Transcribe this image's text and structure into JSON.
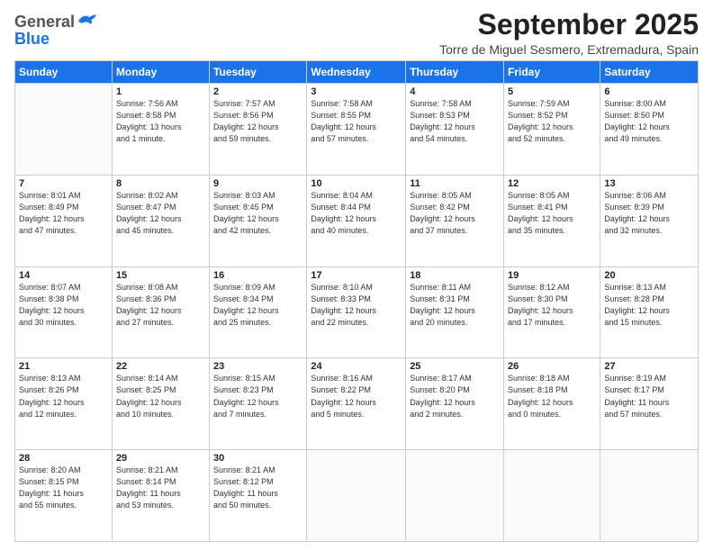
{
  "header": {
    "logo_line1": "General",
    "logo_line2": "Blue",
    "month_title": "September 2025",
    "location": "Torre de Miguel Sesmero, Extremadura, Spain"
  },
  "weekdays": [
    "Sunday",
    "Monday",
    "Tuesday",
    "Wednesday",
    "Thursday",
    "Friday",
    "Saturday"
  ],
  "weeks": [
    [
      {
        "day": "",
        "info": ""
      },
      {
        "day": "1",
        "info": "Sunrise: 7:56 AM\nSunset: 8:58 PM\nDaylight: 13 hours\nand 1 minute."
      },
      {
        "day": "2",
        "info": "Sunrise: 7:57 AM\nSunset: 8:56 PM\nDaylight: 12 hours\nand 59 minutes."
      },
      {
        "day": "3",
        "info": "Sunrise: 7:58 AM\nSunset: 8:55 PM\nDaylight: 12 hours\nand 57 minutes."
      },
      {
        "day": "4",
        "info": "Sunrise: 7:58 AM\nSunset: 8:53 PM\nDaylight: 12 hours\nand 54 minutes."
      },
      {
        "day": "5",
        "info": "Sunrise: 7:59 AM\nSunset: 8:52 PM\nDaylight: 12 hours\nand 52 minutes."
      },
      {
        "day": "6",
        "info": "Sunrise: 8:00 AM\nSunset: 8:50 PM\nDaylight: 12 hours\nand 49 minutes."
      }
    ],
    [
      {
        "day": "7",
        "info": "Sunrise: 8:01 AM\nSunset: 8:49 PM\nDaylight: 12 hours\nand 47 minutes."
      },
      {
        "day": "8",
        "info": "Sunrise: 8:02 AM\nSunset: 8:47 PM\nDaylight: 12 hours\nand 45 minutes."
      },
      {
        "day": "9",
        "info": "Sunrise: 8:03 AM\nSunset: 8:45 PM\nDaylight: 12 hours\nand 42 minutes."
      },
      {
        "day": "10",
        "info": "Sunrise: 8:04 AM\nSunset: 8:44 PM\nDaylight: 12 hours\nand 40 minutes."
      },
      {
        "day": "11",
        "info": "Sunrise: 8:05 AM\nSunset: 8:42 PM\nDaylight: 12 hours\nand 37 minutes."
      },
      {
        "day": "12",
        "info": "Sunrise: 8:05 AM\nSunset: 8:41 PM\nDaylight: 12 hours\nand 35 minutes."
      },
      {
        "day": "13",
        "info": "Sunrise: 8:06 AM\nSunset: 8:39 PM\nDaylight: 12 hours\nand 32 minutes."
      }
    ],
    [
      {
        "day": "14",
        "info": "Sunrise: 8:07 AM\nSunset: 8:38 PM\nDaylight: 12 hours\nand 30 minutes."
      },
      {
        "day": "15",
        "info": "Sunrise: 8:08 AM\nSunset: 8:36 PM\nDaylight: 12 hours\nand 27 minutes."
      },
      {
        "day": "16",
        "info": "Sunrise: 8:09 AM\nSunset: 8:34 PM\nDaylight: 12 hours\nand 25 minutes."
      },
      {
        "day": "17",
        "info": "Sunrise: 8:10 AM\nSunset: 8:33 PM\nDaylight: 12 hours\nand 22 minutes."
      },
      {
        "day": "18",
        "info": "Sunrise: 8:11 AM\nSunset: 8:31 PM\nDaylight: 12 hours\nand 20 minutes."
      },
      {
        "day": "19",
        "info": "Sunrise: 8:12 AM\nSunset: 8:30 PM\nDaylight: 12 hours\nand 17 minutes."
      },
      {
        "day": "20",
        "info": "Sunrise: 8:13 AM\nSunset: 8:28 PM\nDaylight: 12 hours\nand 15 minutes."
      }
    ],
    [
      {
        "day": "21",
        "info": "Sunrise: 8:13 AM\nSunset: 8:26 PM\nDaylight: 12 hours\nand 12 minutes."
      },
      {
        "day": "22",
        "info": "Sunrise: 8:14 AM\nSunset: 8:25 PM\nDaylight: 12 hours\nand 10 minutes."
      },
      {
        "day": "23",
        "info": "Sunrise: 8:15 AM\nSunset: 8:23 PM\nDaylight: 12 hours\nand 7 minutes."
      },
      {
        "day": "24",
        "info": "Sunrise: 8:16 AM\nSunset: 8:22 PM\nDaylight: 12 hours\nand 5 minutes."
      },
      {
        "day": "25",
        "info": "Sunrise: 8:17 AM\nSunset: 8:20 PM\nDaylight: 12 hours\nand 2 minutes."
      },
      {
        "day": "26",
        "info": "Sunrise: 8:18 AM\nSunset: 8:18 PM\nDaylight: 12 hours\nand 0 minutes."
      },
      {
        "day": "27",
        "info": "Sunrise: 8:19 AM\nSunset: 8:17 PM\nDaylight: 11 hours\nand 57 minutes."
      }
    ],
    [
      {
        "day": "28",
        "info": "Sunrise: 8:20 AM\nSunset: 8:15 PM\nDaylight: 11 hours\nand 55 minutes."
      },
      {
        "day": "29",
        "info": "Sunrise: 8:21 AM\nSunset: 8:14 PM\nDaylight: 11 hours\nand 53 minutes."
      },
      {
        "day": "30",
        "info": "Sunrise: 8:21 AM\nSunset: 8:12 PM\nDaylight: 11 hours\nand 50 minutes."
      },
      {
        "day": "",
        "info": ""
      },
      {
        "day": "",
        "info": ""
      },
      {
        "day": "",
        "info": ""
      },
      {
        "day": "",
        "info": ""
      }
    ]
  ]
}
